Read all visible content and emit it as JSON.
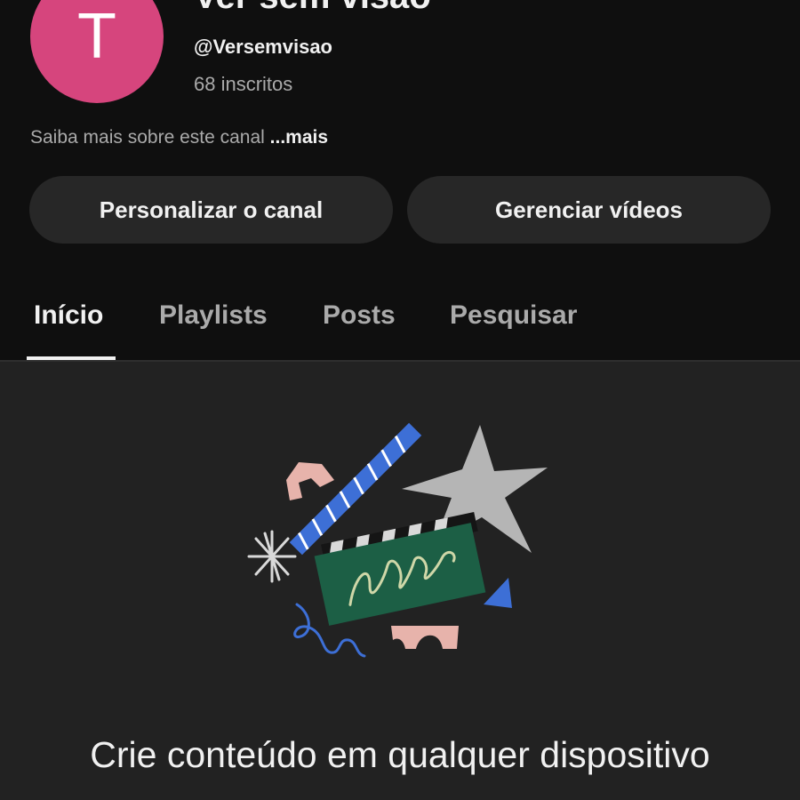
{
  "channel": {
    "avatar_letter": "T",
    "avatar_color": "#d6457d",
    "name": "Ver sem visão",
    "handle": "@Versemvisao",
    "subscribers": "68 inscritos",
    "about_text": "Saiba mais sobre este canal ",
    "about_more": "...mais"
  },
  "actions": {
    "customize_label": "Personalizar o canal",
    "manage_label": "Gerenciar vídeos"
  },
  "tabs": [
    {
      "label": "Início",
      "active": true
    },
    {
      "label": "Playlists",
      "active": false
    },
    {
      "label": "Posts",
      "active": false
    },
    {
      "label": "Pesquisar",
      "active": false
    }
  ],
  "empty_state": {
    "illustration": "clapperboard-illustration",
    "headline": "Crie conteúdo em qualquer dispositivo"
  },
  "colors": {
    "background": "#0f0f0f",
    "content_background": "#222222",
    "button_background": "#272727",
    "text_primary": "#f1f1f1",
    "text_secondary": "#aaaaaa"
  }
}
